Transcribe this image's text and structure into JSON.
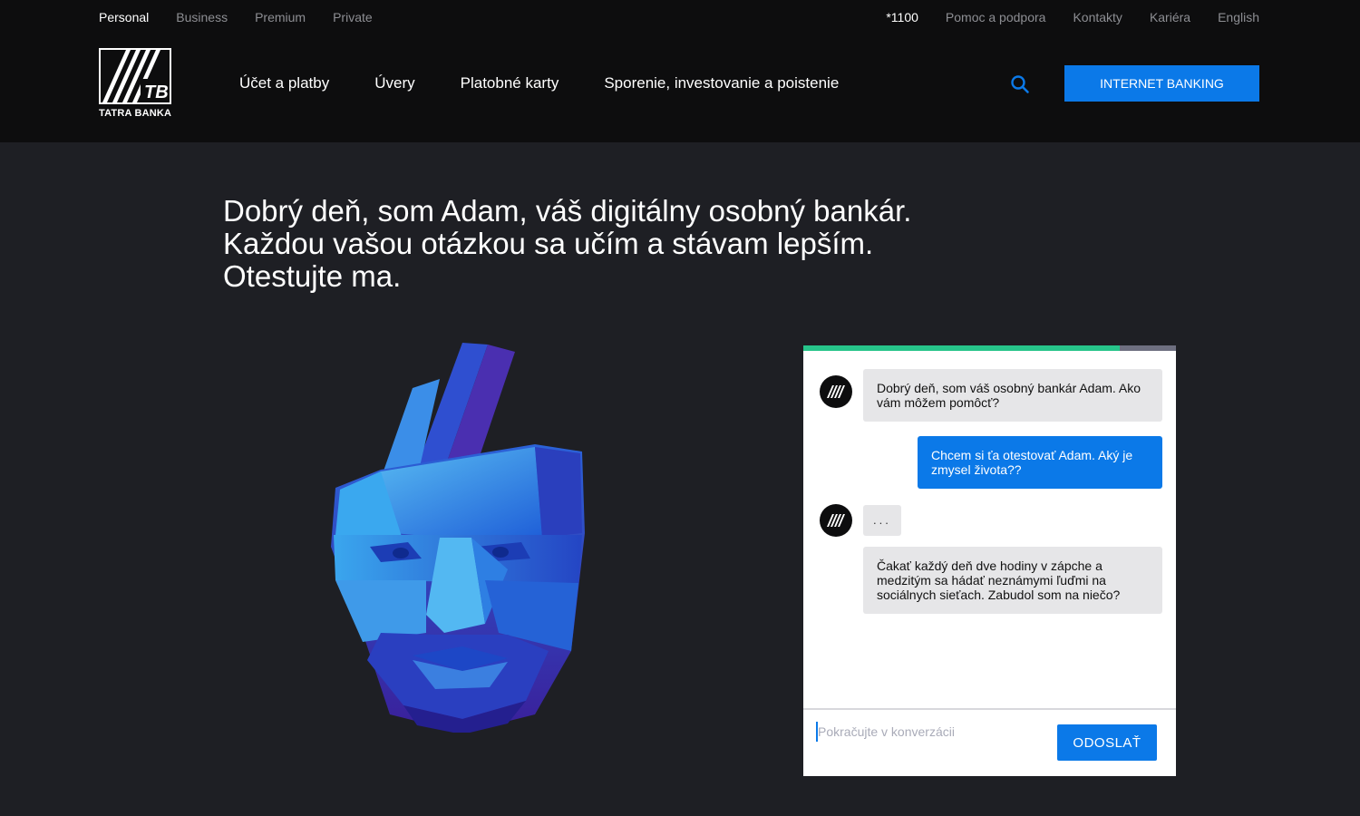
{
  "topbar": {
    "segments": [
      {
        "label": "Personal"
      },
      {
        "label": "Business"
      },
      {
        "label": "Premium"
      },
      {
        "label": "Private"
      }
    ],
    "utility": {
      "phone": "*1100",
      "help": "Pomoc a podpora",
      "contacts": "Kontakty",
      "career": "Kariéra",
      "language": "English"
    }
  },
  "header": {
    "logo_mark": "TB",
    "logo_text": "TATRA BANKA",
    "nav": [
      {
        "label": "Účet a platby"
      },
      {
        "label": "Úvery"
      },
      {
        "label": "Platobné karty"
      },
      {
        "label": "Sporenie, investovanie a poistenie"
      }
    ],
    "internet_banking": "INTERNET BANKING",
    "search_icon": "search-icon"
  },
  "hero": {
    "lines": [
      "Dobrý deň, som Adam, váš digitálny osobný bankár.",
      "Každou vašou otázkou sa učím a stávam lepším.",
      "Otestujte ma."
    ]
  },
  "chat": {
    "progress": 0.85,
    "messages": [
      {
        "from": "bot",
        "text": "Dobrý deň, som váš osobný bankár Adam. Ako vám môžem pomôcť?"
      },
      {
        "from": "user",
        "text": "Chcem si ťa otestovať Adam. Aký je zmysel života??"
      },
      {
        "from": "bot",
        "text": "..."
      },
      {
        "from": "bot",
        "text": "Čakať každý deň dve hodiny v zápche a medzitým sa hádať neznámymi ľuďmi na sociálnych sieťach. Zabudol som na niečo?"
      }
    ],
    "input_placeholder": "Pokračujte v konverzácii",
    "send_label": "ODOSLAŤ"
  },
  "colors": {
    "accent": "#0b79e8",
    "progress": "#27c48a",
    "background": "#1e1f24",
    "header": "#0d0d0e"
  }
}
